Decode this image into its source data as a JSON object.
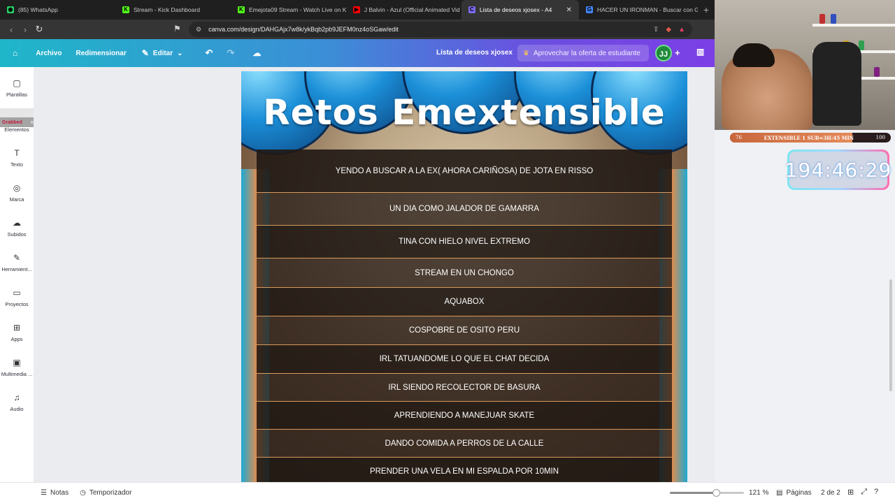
{
  "browser": {
    "tabs": [
      {
        "label": "(85) WhatsApp",
        "icon": "whatsapp-icon",
        "color": "#25d366",
        "glyph": "◉"
      },
      {
        "label": "Stream - Kick Dashboard",
        "icon": "kick-icon",
        "color": "#53fc18",
        "glyph": "K"
      },
      {
        "label": "Emejota09 Stream - Watch Live on Ki",
        "icon": "kick-icon",
        "color": "#53fc18",
        "glyph": "K"
      },
      {
        "label": "J Balvin - Azul (Official Animated Vid",
        "icon": "youtube-icon",
        "color": "#ff0000",
        "glyph": "▶"
      },
      {
        "label": "Lista de deseos xjosex - A4",
        "icon": "canva-icon",
        "color": "#7d6cf0",
        "glyph": "C",
        "active": true
      },
      {
        "label": "HACER UN IRONMAN - Buscar con G",
        "icon": "google-icon",
        "color": "#4285f4",
        "glyph": "G"
      }
    ],
    "url": "canva.com/design/DAHGAjx7w8k/ykBqb2pb9JEFM0nz4oSGaw/edit"
  },
  "canva_header": {
    "archivo": "Archivo",
    "redimensionar": "Redimensionar",
    "editar": "Editar",
    "doc_name": "Lista de deseos xjosex",
    "offer": "Aprovechar la oferta de estudiante",
    "avatar_initials": "JJ"
  },
  "rail": [
    {
      "label": "Plantillas",
      "icon": "templates-icon",
      "glyph": "▢"
    },
    {
      "label": "Elementos",
      "icon": "elements-icon",
      "glyph": "◈"
    },
    {
      "label": "Texto",
      "icon": "text-icon",
      "glyph": "T"
    },
    {
      "label": "Marca",
      "icon": "brand-icon",
      "glyph": "◎"
    },
    {
      "label": "Subidos",
      "icon": "upload-icon",
      "glyph": "☁"
    },
    {
      "label": "Herramient...",
      "icon": "tools-icon",
      "glyph": "✎"
    },
    {
      "label": "Proyectos",
      "icon": "folder-icon",
      "glyph": "▭"
    },
    {
      "label": "Apps",
      "icon": "apps-icon",
      "glyph": "⊞"
    },
    {
      "label": "Multimedia ...",
      "icon": "media-icon",
      "glyph": "▣"
    },
    {
      "label": "Audio",
      "icon": "audio-icon",
      "glyph": "♫"
    }
  ],
  "drag_chip": {
    "left": "Grabbed",
    "right": "xddd"
  },
  "design": {
    "title": "Retos Emextensible",
    "items": [
      "YENDO A BUSCAR A LA EX( AHORA CARIÑOSA) DE JOTA EN RISSO",
      "UN DIA COMO JALADOR DE GAMARRA",
      "TINA CON HIELO NIVEL EXTREMO",
      "STREAM EN UN CHONGO",
      "AQUABOX",
      "COSPOBRE DE OSITO PERU",
      "IRL  TATUANDOME LO QUE EL CHAT DECIDA",
      "IRL SIENDO RECOLECTOR DE BASURA",
      "APRENDIENDO A MANEJUAR SKATE",
      "DANDO COMIDA A PERROS DE LA CALLE",
      "PRENDER UNA VELA EN MI ESPALDA POR 10MIN"
    ]
  },
  "bottombar": {
    "notas": "Notas",
    "temporizador": "Temporizador",
    "zoom": "121 %",
    "zoom_fraction": 0.62,
    "paginas": "Páginas",
    "page_count": "2 de 2"
  },
  "overlay": {
    "sub_left": "76",
    "sub_center": "EXTENSIBLE 1 SUB=3H:45 MIN",
    "sub_right": "100",
    "sub_fraction": 0.76,
    "timer": "194:46:29"
  }
}
